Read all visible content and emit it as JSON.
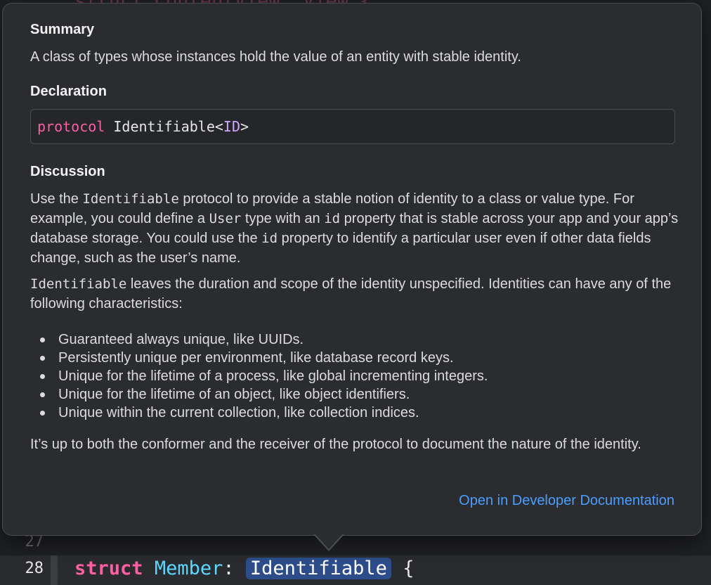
{
  "editor": {
    "faded_line": "struct ContentView: View {",
    "lines": [
      {
        "number": "27"
      },
      {
        "number": "28"
      }
    ],
    "code": {
      "keyword": "struct",
      "type_name": "Member",
      "colon": ": ",
      "protocol_ref": "Identifiable",
      "brace": " {"
    }
  },
  "popover": {
    "summary_title": "Summary",
    "summary_text": "A class of types whose instances hold the value of an entity with stable identity.",
    "declaration_title": "Declaration",
    "declaration": {
      "keyword": "protocol",
      "name": " Identifiable<",
      "generic": "ID",
      "close": ">"
    },
    "discussion_title": "Discussion",
    "discussion_p1": {
      "t1": "Use the ",
      "code1": "Identifiable",
      "t2": " protocol to provide a stable notion of identity to a class or value type. For example, you could define a ",
      "code2": "User",
      "t3": " type with an ",
      "code3": "id",
      "t4": " property that is stable across your app and your app’s database storage. You could use the ",
      "code4": "id",
      "t5": " property to identify a particular user even if other data fields change, such as the user’s name."
    },
    "discussion_p2": {
      "code1": "Identifiable",
      "t1": " leaves the duration and scope of the identity unspecified. Identities can have any of the following characteristics:"
    },
    "bullets": [
      "Guaranteed always unique, like UUIDs.",
      "Persistently unique per environment, like database record keys.",
      "Unique for the lifetime of a process, like global incrementing integers.",
      "Unique for the lifetime of an object, like object identifiers.",
      "Unique within the current collection, like collection indices."
    ],
    "discussion_p3": "It’s up to both the conformer and the receiver of the protocol to document the nature of the identity.",
    "link_label": "Open in Developer Documentation"
  },
  "colors": {
    "keyword": "#fc5fa3",
    "type": "#5dd8ff",
    "link": "#4a9eff",
    "highlight": "#2c4d8a"
  }
}
